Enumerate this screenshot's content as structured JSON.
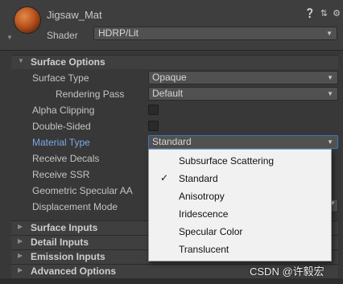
{
  "header": {
    "material_name": "Jigsaw_Mat",
    "shader_label": "Shader",
    "shader_value": "HDRP/Lit",
    "icons": [
      "help-icon",
      "preset-icon",
      "settings-icon"
    ]
  },
  "surface_options": {
    "title": "Surface Options",
    "rows": {
      "surface_type": {
        "label": "Surface Type",
        "value": "Opaque"
      },
      "rendering_pass": {
        "label": "Rendering Pass",
        "value": "Default"
      },
      "alpha_clipping": {
        "label": "Alpha Clipping",
        "checked": false
      },
      "double_sided": {
        "label": "Double-Sided",
        "checked": false
      },
      "material_type": {
        "label": "Material Type",
        "value": "Standard"
      },
      "receive_decals": {
        "label": "Receive Decals"
      },
      "receive_ssr": {
        "label": "Receive SSR"
      },
      "geometric_specular_aa": {
        "label": "Geometric Specular AA"
      },
      "displacement_mode": {
        "label": "Displacement Mode"
      }
    }
  },
  "collapsed_sections": {
    "surface_inputs": "Surface Inputs",
    "detail_inputs": "Detail Inputs",
    "emission_inputs": "Emission Inputs",
    "advanced_options": "Advanced Options"
  },
  "material_type_menu": {
    "options": [
      "Subsurface Scattering",
      "Standard",
      "Anisotropy",
      "Iridescence",
      "Specular Color",
      "Translucent"
    ],
    "selected": "Standard",
    "check_glyph": "✓"
  },
  "watermark": "CSDN @许毅宏",
  "colors": {
    "background": "#383838",
    "active_label": "#7ba8e6",
    "popup_bg": "#f1f1f1",
    "focus_border": "#3a79bb"
  }
}
